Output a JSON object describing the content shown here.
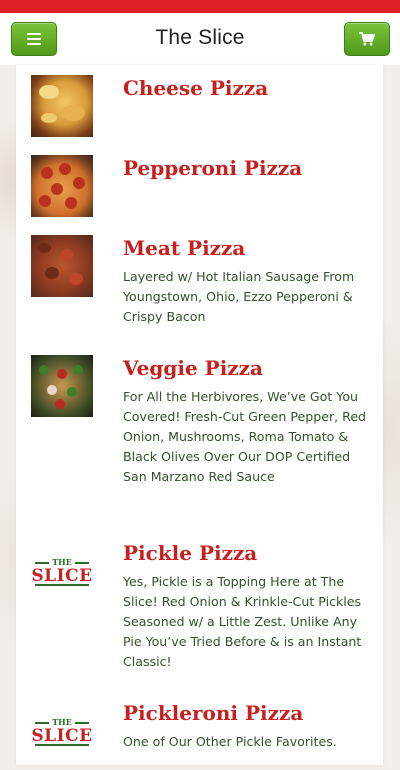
{
  "header": {
    "title": "The Slice",
    "menu_icon": "menu-icon",
    "cart_icon": "cart-icon"
  },
  "colors": {
    "brand_red": "#dd1f26",
    "button_green": "#5aa820",
    "item_title": "#c8201f",
    "item_desc": "#34512c"
  },
  "logo": {
    "top": "THE",
    "bottom": "SLICE"
  },
  "menu_items": [
    {
      "name": "Cheese Pizza",
      "description": "",
      "image": "cheese-pizza-photo"
    },
    {
      "name": "Pepperoni Pizza",
      "description": "",
      "image": "pepperoni-pizza-photo"
    },
    {
      "name": "Meat Pizza",
      "description": "Layered w/ Hot Italian Sausage From Youngstown, Ohio, Ezzo Pepperoni & Crispy Bacon",
      "image": "meat-pizza-photo"
    },
    {
      "name": "Veggie Pizza",
      "description": "For All the Herbivores, We’ve Got You Covered! Fresh-Cut Green Pepper, Red Onion, Mushrooms, Roma Tomato & Black Olives Over Our DOP Certified San Marzano Red Sauce",
      "image": "veggie-pizza-photo"
    },
    {
      "name": "Pickle Pizza",
      "description": "Yes, Pickle is a Topping Here at The Slice! Red Onion & Krinkle-Cut Pickles Seasoned w/ a Little Zest. Unlike Any Pie You’ve Tried Before & is an Instant Classic!",
      "image": "the-slice-logo"
    },
    {
      "name": "Pickleroni Pizza",
      "description": "One of Our Other Pickle Favorites.",
      "image": "the-slice-logo"
    }
  ]
}
